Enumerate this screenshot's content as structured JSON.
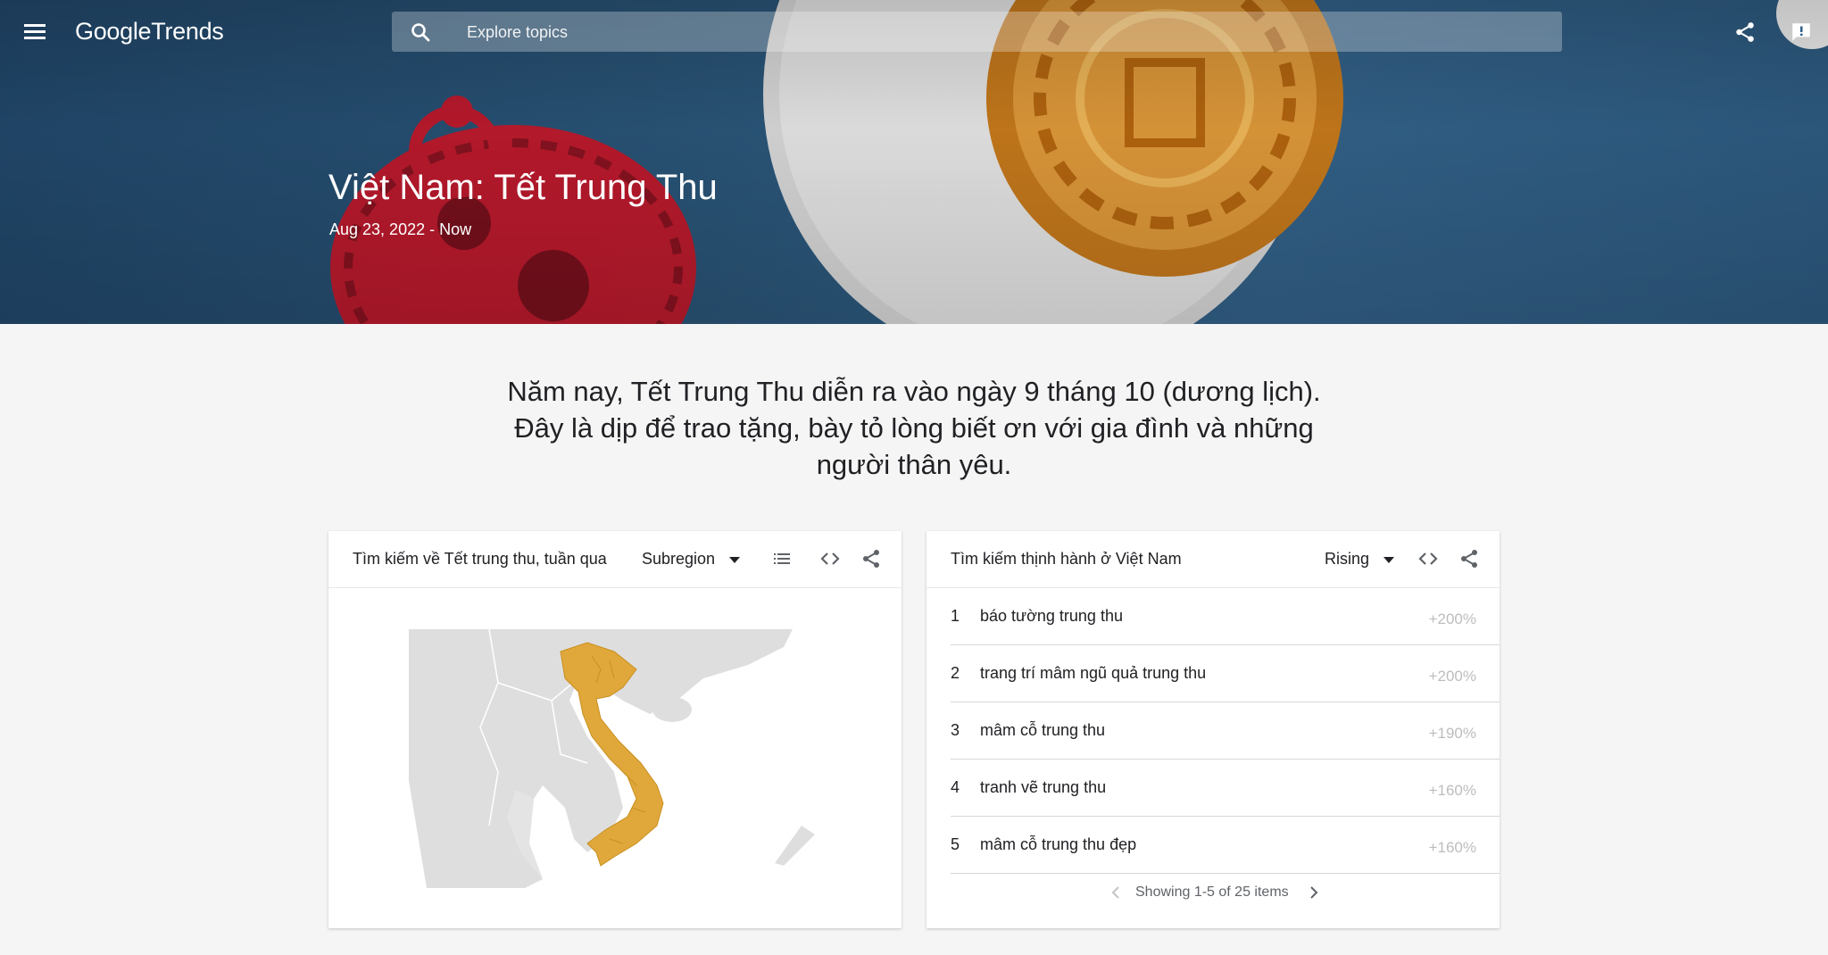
{
  "app": {
    "logo_google": "Google",
    "logo_trends": "Trends"
  },
  "search": {
    "placeholder": "Explore topics"
  },
  "hero": {
    "title": "Việt Nam: Tết Trung Thu",
    "date_range": "Aug 23, 2022 - Now"
  },
  "intro": {
    "text": "Năm nay, Tết Trung Thu diễn ra vào ngày 9 tháng 10 (dương lịch). Đây là dịp để trao tặng, bày tỏ lòng biết ơn với gia đình và những người thân yêu."
  },
  "map_card": {
    "title": "Tìm kiếm về Tết trung thu, tuần qua",
    "resolution": "Subregion",
    "highlight_color": "#e0a83a"
  },
  "trending_card": {
    "title": "Tìm kiếm thịnh hành ở Việt Nam",
    "filter": "Rising",
    "rows": [
      {
        "rank": "1",
        "term": "báo tường trung thu",
        "change": "+200%"
      },
      {
        "rank": "2",
        "term": "trang trí mâm ngũ quả trung thu",
        "change": "+200%"
      },
      {
        "rank": "3",
        "term": "mâm cỗ trung thu",
        "change": "+190%"
      },
      {
        "rank": "4",
        "term": "tranh vẽ trung thu",
        "change": "+160%"
      },
      {
        "rank": "5",
        "term": "mâm cỗ trung thu đẹp",
        "change": "+160%"
      }
    ],
    "pager_text": "Showing 1-5 of 25 items"
  }
}
